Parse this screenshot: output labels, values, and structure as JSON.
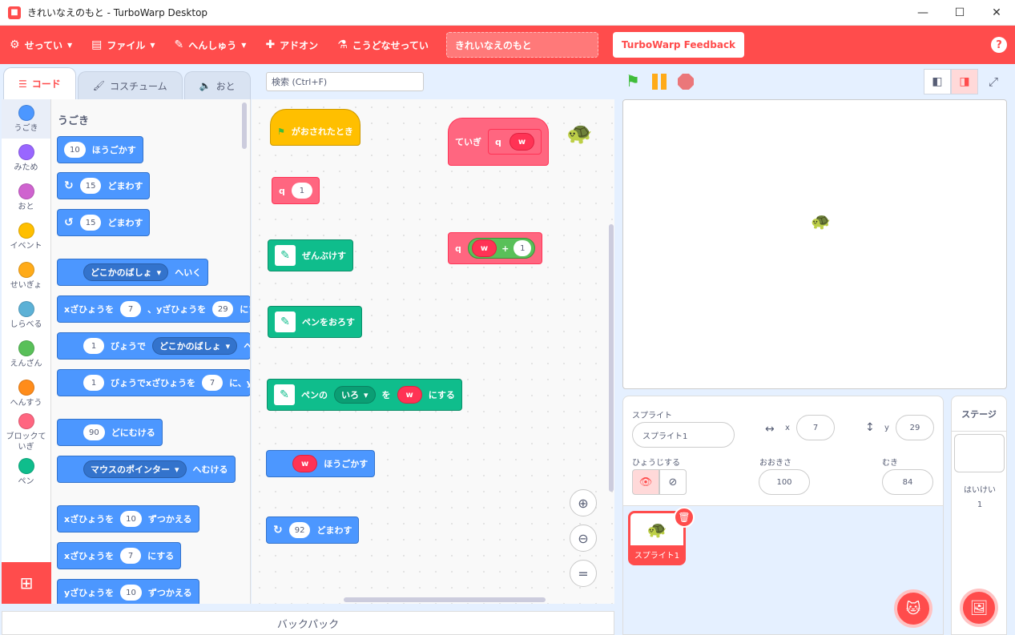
{
  "window": {
    "title": "きれいなえのもと - TurboWarp Desktop"
  },
  "menubar": {
    "items": [
      "せってい",
      "ファイル",
      "へんしゅう",
      "アドオン",
      "こうどなせってい"
    ],
    "project_title": "きれいなえのもと",
    "feedback": "TurboWarp Feedback"
  },
  "tabs": [
    "コード",
    "コスチューム",
    "おと"
  ],
  "search": {
    "placeholder": "検索 (Ctrl+F)"
  },
  "categories": [
    {
      "label": "うごき",
      "color": "#4c97ff"
    },
    {
      "label": "みため",
      "color": "#9966ff"
    },
    {
      "label": "おと",
      "color": "#cf63cf"
    },
    {
      "label": "イベント",
      "color": "#ffbf00"
    },
    {
      "label": "せいぎょ",
      "color": "#ffab19"
    },
    {
      "label": "しらべる",
      "color": "#5cb1d6"
    },
    {
      "label": "えんざん",
      "color": "#59c059"
    },
    {
      "label": "へんすう",
      "color": "#ff8c1a"
    },
    {
      "label": "ブロックていぎ",
      "color": "#ff6680"
    },
    {
      "label": "ペン",
      "color": "#0fbd8c"
    }
  ],
  "palette": {
    "heading": "うごき",
    "b_move": {
      "n": "10",
      "t": "ほうごかす"
    },
    "b_turn_r": {
      "n": "15",
      "t": "どまわす"
    },
    "b_turn_l": {
      "n": "15",
      "t": "どまわす"
    },
    "b_goto": {
      "d": "どこかのばしょ",
      "t": "へいく"
    },
    "b_gotoxy": {
      "a": "xざひょうを",
      "x": "7",
      "b": "、yざひょうを",
      "y": "29",
      "c": "にする"
    },
    "b_glide": {
      "n": "1",
      "a": "びょうで",
      "d": "どこかのばしょ",
      "b": "へい"
    },
    "b_glidexy": {
      "n": "1",
      "a": "びょうでxざひょうを",
      "x": "7",
      "b": "に、yざ"
    },
    "b_point": {
      "n": "90",
      "t": "どにむける"
    },
    "b_pointto": {
      "d": "マウスのポインター",
      "t": "へむける"
    },
    "b_changex": {
      "a": "xざひょうを",
      "n": "10",
      "b": "ずつかえる"
    },
    "b_setx": {
      "a": "xざひょうを",
      "n": "7",
      "b": "にする"
    },
    "b_changey": {
      "a": "yざひょうを",
      "n": "10",
      "b": "ずつかえる"
    }
  },
  "scripts": {
    "hat": "がおされたとき",
    "call_q": {
      "name": "q",
      "arg": "1"
    },
    "clear": "ぜんぶけす",
    "pendown": "ペンをおろす",
    "setcolor": {
      "a": "ペンの",
      "d": "いろ",
      "b": "を",
      "r": "w",
      "c": "にする"
    },
    "move_w": {
      "r": "w",
      "t": "ほうごかす"
    },
    "turn_92": {
      "n": "92",
      "t": "どまわす"
    },
    "define": {
      "label": "ていぎ",
      "name": "q",
      "param": "w"
    },
    "call_q2": {
      "name": "q",
      "r": "w",
      "op": "+",
      "n": "1"
    }
  },
  "backpack": "バックパック",
  "sprite_info": {
    "sprite_label": "スプライト",
    "sprite_name": "スプライト1",
    "x_label": "x",
    "x": "7",
    "y_label": "y",
    "y": "29",
    "show_label": "ひょうじする",
    "size_label": "おおきさ",
    "size": "100",
    "dir_label": "むき",
    "dir": "84"
  },
  "sprite_tile": {
    "name": "スプライト1"
  },
  "stage_pane": {
    "title": "ステージ",
    "bg_label": "はいけい",
    "bg_count": "1"
  }
}
